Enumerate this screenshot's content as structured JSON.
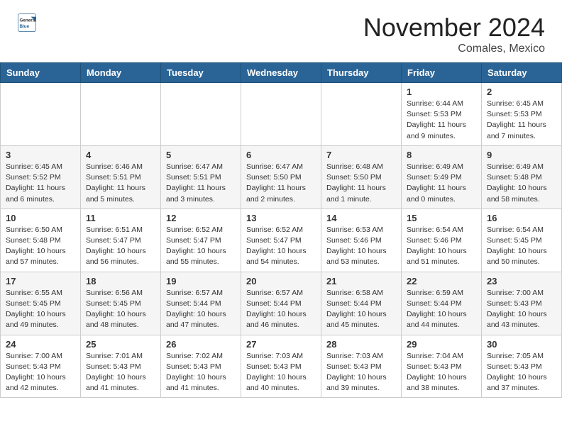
{
  "header": {
    "logo_general": "General",
    "logo_blue": "Blue",
    "month_title": "November 2024",
    "location": "Comales, Mexico"
  },
  "days_of_week": [
    "Sunday",
    "Monday",
    "Tuesday",
    "Wednesday",
    "Thursday",
    "Friday",
    "Saturday"
  ],
  "weeks": [
    [
      {
        "day": "",
        "info": ""
      },
      {
        "day": "",
        "info": ""
      },
      {
        "day": "",
        "info": ""
      },
      {
        "day": "",
        "info": ""
      },
      {
        "day": "",
        "info": ""
      },
      {
        "day": "1",
        "info": "Sunrise: 6:44 AM\nSunset: 5:53 PM\nDaylight: 11 hours and 9 minutes."
      },
      {
        "day": "2",
        "info": "Sunrise: 6:45 AM\nSunset: 5:53 PM\nDaylight: 11 hours and 7 minutes."
      }
    ],
    [
      {
        "day": "3",
        "info": "Sunrise: 6:45 AM\nSunset: 5:52 PM\nDaylight: 11 hours and 6 minutes."
      },
      {
        "day": "4",
        "info": "Sunrise: 6:46 AM\nSunset: 5:51 PM\nDaylight: 11 hours and 5 minutes."
      },
      {
        "day": "5",
        "info": "Sunrise: 6:47 AM\nSunset: 5:51 PM\nDaylight: 11 hours and 3 minutes."
      },
      {
        "day": "6",
        "info": "Sunrise: 6:47 AM\nSunset: 5:50 PM\nDaylight: 11 hours and 2 minutes."
      },
      {
        "day": "7",
        "info": "Sunrise: 6:48 AM\nSunset: 5:50 PM\nDaylight: 11 hours and 1 minute."
      },
      {
        "day": "8",
        "info": "Sunrise: 6:49 AM\nSunset: 5:49 PM\nDaylight: 11 hours and 0 minutes."
      },
      {
        "day": "9",
        "info": "Sunrise: 6:49 AM\nSunset: 5:48 PM\nDaylight: 10 hours and 58 minutes."
      }
    ],
    [
      {
        "day": "10",
        "info": "Sunrise: 6:50 AM\nSunset: 5:48 PM\nDaylight: 10 hours and 57 minutes."
      },
      {
        "day": "11",
        "info": "Sunrise: 6:51 AM\nSunset: 5:47 PM\nDaylight: 10 hours and 56 minutes."
      },
      {
        "day": "12",
        "info": "Sunrise: 6:52 AM\nSunset: 5:47 PM\nDaylight: 10 hours and 55 minutes."
      },
      {
        "day": "13",
        "info": "Sunrise: 6:52 AM\nSunset: 5:47 PM\nDaylight: 10 hours and 54 minutes."
      },
      {
        "day": "14",
        "info": "Sunrise: 6:53 AM\nSunset: 5:46 PM\nDaylight: 10 hours and 53 minutes."
      },
      {
        "day": "15",
        "info": "Sunrise: 6:54 AM\nSunset: 5:46 PM\nDaylight: 10 hours and 51 minutes."
      },
      {
        "day": "16",
        "info": "Sunrise: 6:54 AM\nSunset: 5:45 PM\nDaylight: 10 hours and 50 minutes."
      }
    ],
    [
      {
        "day": "17",
        "info": "Sunrise: 6:55 AM\nSunset: 5:45 PM\nDaylight: 10 hours and 49 minutes."
      },
      {
        "day": "18",
        "info": "Sunrise: 6:56 AM\nSunset: 5:45 PM\nDaylight: 10 hours and 48 minutes."
      },
      {
        "day": "19",
        "info": "Sunrise: 6:57 AM\nSunset: 5:44 PM\nDaylight: 10 hours and 47 minutes."
      },
      {
        "day": "20",
        "info": "Sunrise: 6:57 AM\nSunset: 5:44 PM\nDaylight: 10 hours and 46 minutes."
      },
      {
        "day": "21",
        "info": "Sunrise: 6:58 AM\nSunset: 5:44 PM\nDaylight: 10 hours and 45 minutes."
      },
      {
        "day": "22",
        "info": "Sunrise: 6:59 AM\nSunset: 5:44 PM\nDaylight: 10 hours and 44 minutes."
      },
      {
        "day": "23",
        "info": "Sunrise: 7:00 AM\nSunset: 5:43 PM\nDaylight: 10 hours and 43 minutes."
      }
    ],
    [
      {
        "day": "24",
        "info": "Sunrise: 7:00 AM\nSunset: 5:43 PM\nDaylight: 10 hours and 42 minutes."
      },
      {
        "day": "25",
        "info": "Sunrise: 7:01 AM\nSunset: 5:43 PM\nDaylight: 10 hours and 41 minutes."
      },
      {
        "day": "26",
        "info": "Sunrise: 7:02 AM\nSunset: 5:43 PM\nDaylight: 10 hours and 41 minutes."
      },
      {
        "day": "27",
        "info": "Sunrise: 7:03 AM\nSunset: 5:43 PM\nDaylight: 10 hours and 40 minutes."
      },
      {
        "day": "28",
        "info": "Sunrise: 7:03 AM\nSunset: 5:43 PM\nDaylight: 10 hours and 39 minutes."
      },
      {
        "day": "29",
        "info": "Sunrise: 7:04 AM\nSunset: 5:43 PM\nDaylight: 10 hours and 38 minutes."
      },
      {
        "day": "30",
        "info": "Sunrise: 7:05 AM\nSunset: 5:43 PM\nDaylight: 10 hours and 37 minutes."
      }
    ]
  ]
}
